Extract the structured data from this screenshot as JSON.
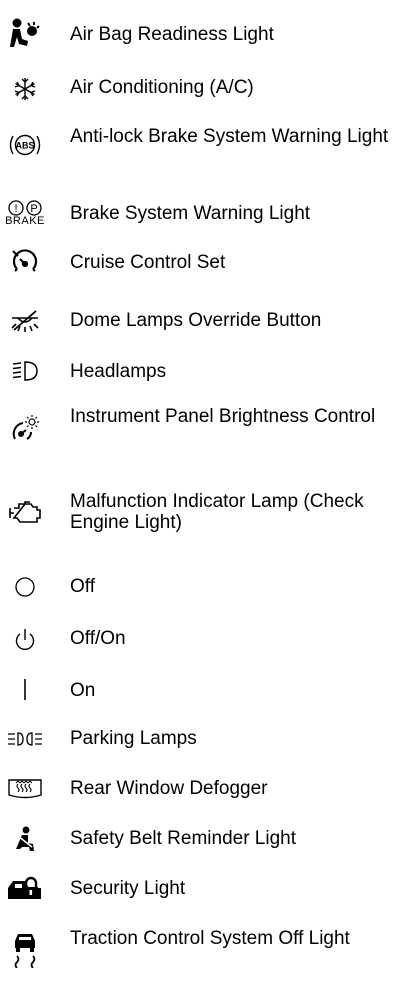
{
  "items": [
    {
      "icon": "airbag-readiness-icon",
      "label": "Air Bag Readiness Light"
    },
    {
      "icon": "air-conditioning-icon",
      "label": "Air Conditioning (A/C)"
    },
    {
      "icon": "abs-warning-icon",
      "icon_text": "ABS",
      "label": "Anti-lock Brake System Warning Light"
    },
    {
      "icon": "brake-system-icon",
      "icon_text": "BRAKE",
      "label": "Brake System Warning Light"
    },
    {
      "icon": "cruise-control-icon",
      "label": "Cruise Control Set"
    },
    {
      "icon": "dome-lamps-override-icon",
      "label": "Dome Lamps Override Button"
    },
    {
      "icon": "headlamps-icon",
      "label": "Headlamps"
    },
    {
      "icon": "instrument-panel-brightness-icon",
      "label": "Instrument Panel Brightness Control"
    },
    {
      "icon": "check-engine-icon",
      "label": "Malfunction Indicator Lamp (Check Engine Light)"
    },
    {
      "icon": "off-circle-icon",
      "label": "Off"
    },
    {
      "icon": "power-off-on-icon",
      "label": "Off/On"
    },
    {
      "icon": "on-bar-icon",
      "label": "On"
    },
    {
      "icon": "parking-lamps-icon",
      "label": "Parking Lamps"
    },
    {
      "icon": "rear-defogger-icon",
      "label": "Rear Window Defogger"
    },
    {
      "icon": "safety-belt-icon",
      "label": "Safety Belt Reminder Light"
    },
    {
      "icon": "security-light-icon",
      "label": "Security Light"
    },
    {
      "icon": "traction-control-off-icon",
      "label": "Traction Control System Off Light"
    }
  ]
}
